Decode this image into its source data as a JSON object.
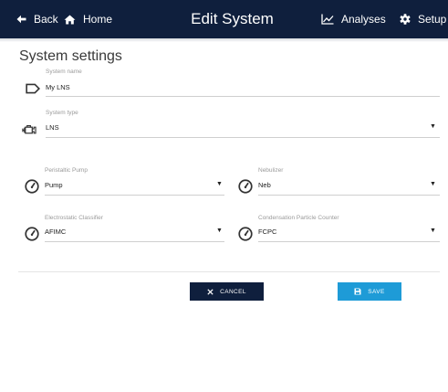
{
  "header": {
    "back_label": "Back",
    "home_label": "Home",
    "title": "Edit System",
    "analyses_label": "Analyses",
    "setup_label": "Setup",
    "background": "#0f1f3d"
  },
  "page": {
    "heading": "System settings"
  },
  "fields": {
    "system_name": {
      "label": "System name",
      "value": "My LNS",
      "icon": "tag-icon"
    },
    "system_type": {
      "label": "System type",
      "value": "LNS",
      "icon": "engine-icon"
    },
    "peristaltic_pump": {
      "label": "Peristaltic Pump",
      "value": "Pump",
      "icon": "gauge-icon"
    },
    "nebulizer": {
      "label": "Nebulizer",
      "value": "Neb",
      "icon": "gauge-icon"
    },
    "electrostatic_classifier": {
      "label": "Electrostatic Classifier",
      "value": "AFIMC",
      "icon": "gauge-icon"
    },
    "cpc": {
      "label": "Condensation Particle Counter",
      "value": "FCPC",
      "icon": "gauge-icon"
    }
  },
  "actions": {
    "cancel_label": "CANCEL",
    "save_label": "SAVE",
    "cancel_color": "#0f1f3d",
    "save_color": "#1e9bd7"
  }
}
